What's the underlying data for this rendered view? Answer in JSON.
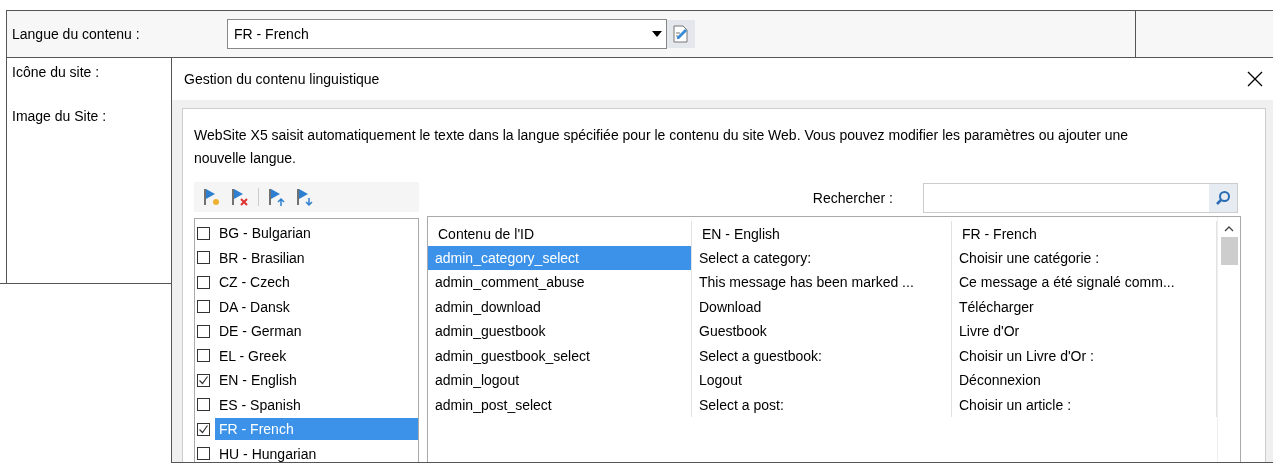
{
  "form": {
    "fields": [
      {
        "label": "Langue du contenu :",
        "kind": "dropdown",
        "value": "FR - French"
      },
      {
        "label": "Icône du site :",
        "kind": "empty"
      },
      {
        "label": "Image du Site :",
        "kind": "empty"
      }
    ]
  },
  "dialog": {
    "title": "Gestion du contenu linguistique",
    "description": "WebSite X5 saisit automatiquement le texte dans la langue spécifiée pour le contenu du site Web. Vous pouvez modifier les paramètres ou ajouter une nouvelle langue.",
    "languages": [
      {
        "label": "BG - Bulgarian",
        "checked": false,
        "selected": false
      },
      {
        "label": "BR - Brasilian",
        "checked": false,
        "selected": false
      },
      {
        "label": "CZ - Czech",
        "checked": false,
        "selected": false
      },
      {
        "label": "DA - Dansk",
        "checked": false,
        "selected": false
      },
      {
        "label": "DE - German",
        "checked": false,
        "selected": false
      },
      {
        "label": "EL - Greek",
        "checked": false,
        "selected": false
      },
      {
        "label": "EN - English",
        "checked": true,
        "selected": false
      },
      {
        "label": "ES - Spanish",
        "checked": false,
        "selected": false
      },
      {
        "label": "FR - French",
        "checked": true,
        "selected": true
      },
      {
        "label": "HU - Hungarian",
        "checked": false,
        "selected": false
      }
    ],
    "search": {
      "label": "Rechercher :"
    },
    "table": {
      "columns": [
        "Contenu de l'ID",
        "EN - English",
        "FR - French"
      ],
      "rows": [
        {
          "cells": [
            "admin_category_select",
            "Select a category:",
            "Choisir une catégorie :"
          ],
          "selected": true
        },
        {
          "cells": [
            "admin_comment_abuse",
            "This message has been marked ...",
            "Ce message a été signalé comm..."
          ],
          "selected": false
        },
        {
          "cells": [
            "admin_download",
            "Download",
            "Télécharger"
          ],
          "selected": false
        },
        {
          "cells": [
            "admin_guestbook",
            "Guestbook",
            "Livre d'Or"
          ],
          "selected": false
        },
        {
          "cells": [
            "admin_guestbook_select",
            "Select a guestbook:",
            "Choisir un Livre d'Or :"
          ],
          "selected": false
        },
        {
          "cells": [
            "admin_logout",
            "Logout",
            "Déconnexion"
          ],
          "selected": false
        },
        {
          "cells": [
            "admin_post_select",
            "Select a post:",
            "Choisir un article :"
          ],
          "selected": false
        }
      ]
    }
  }
}
